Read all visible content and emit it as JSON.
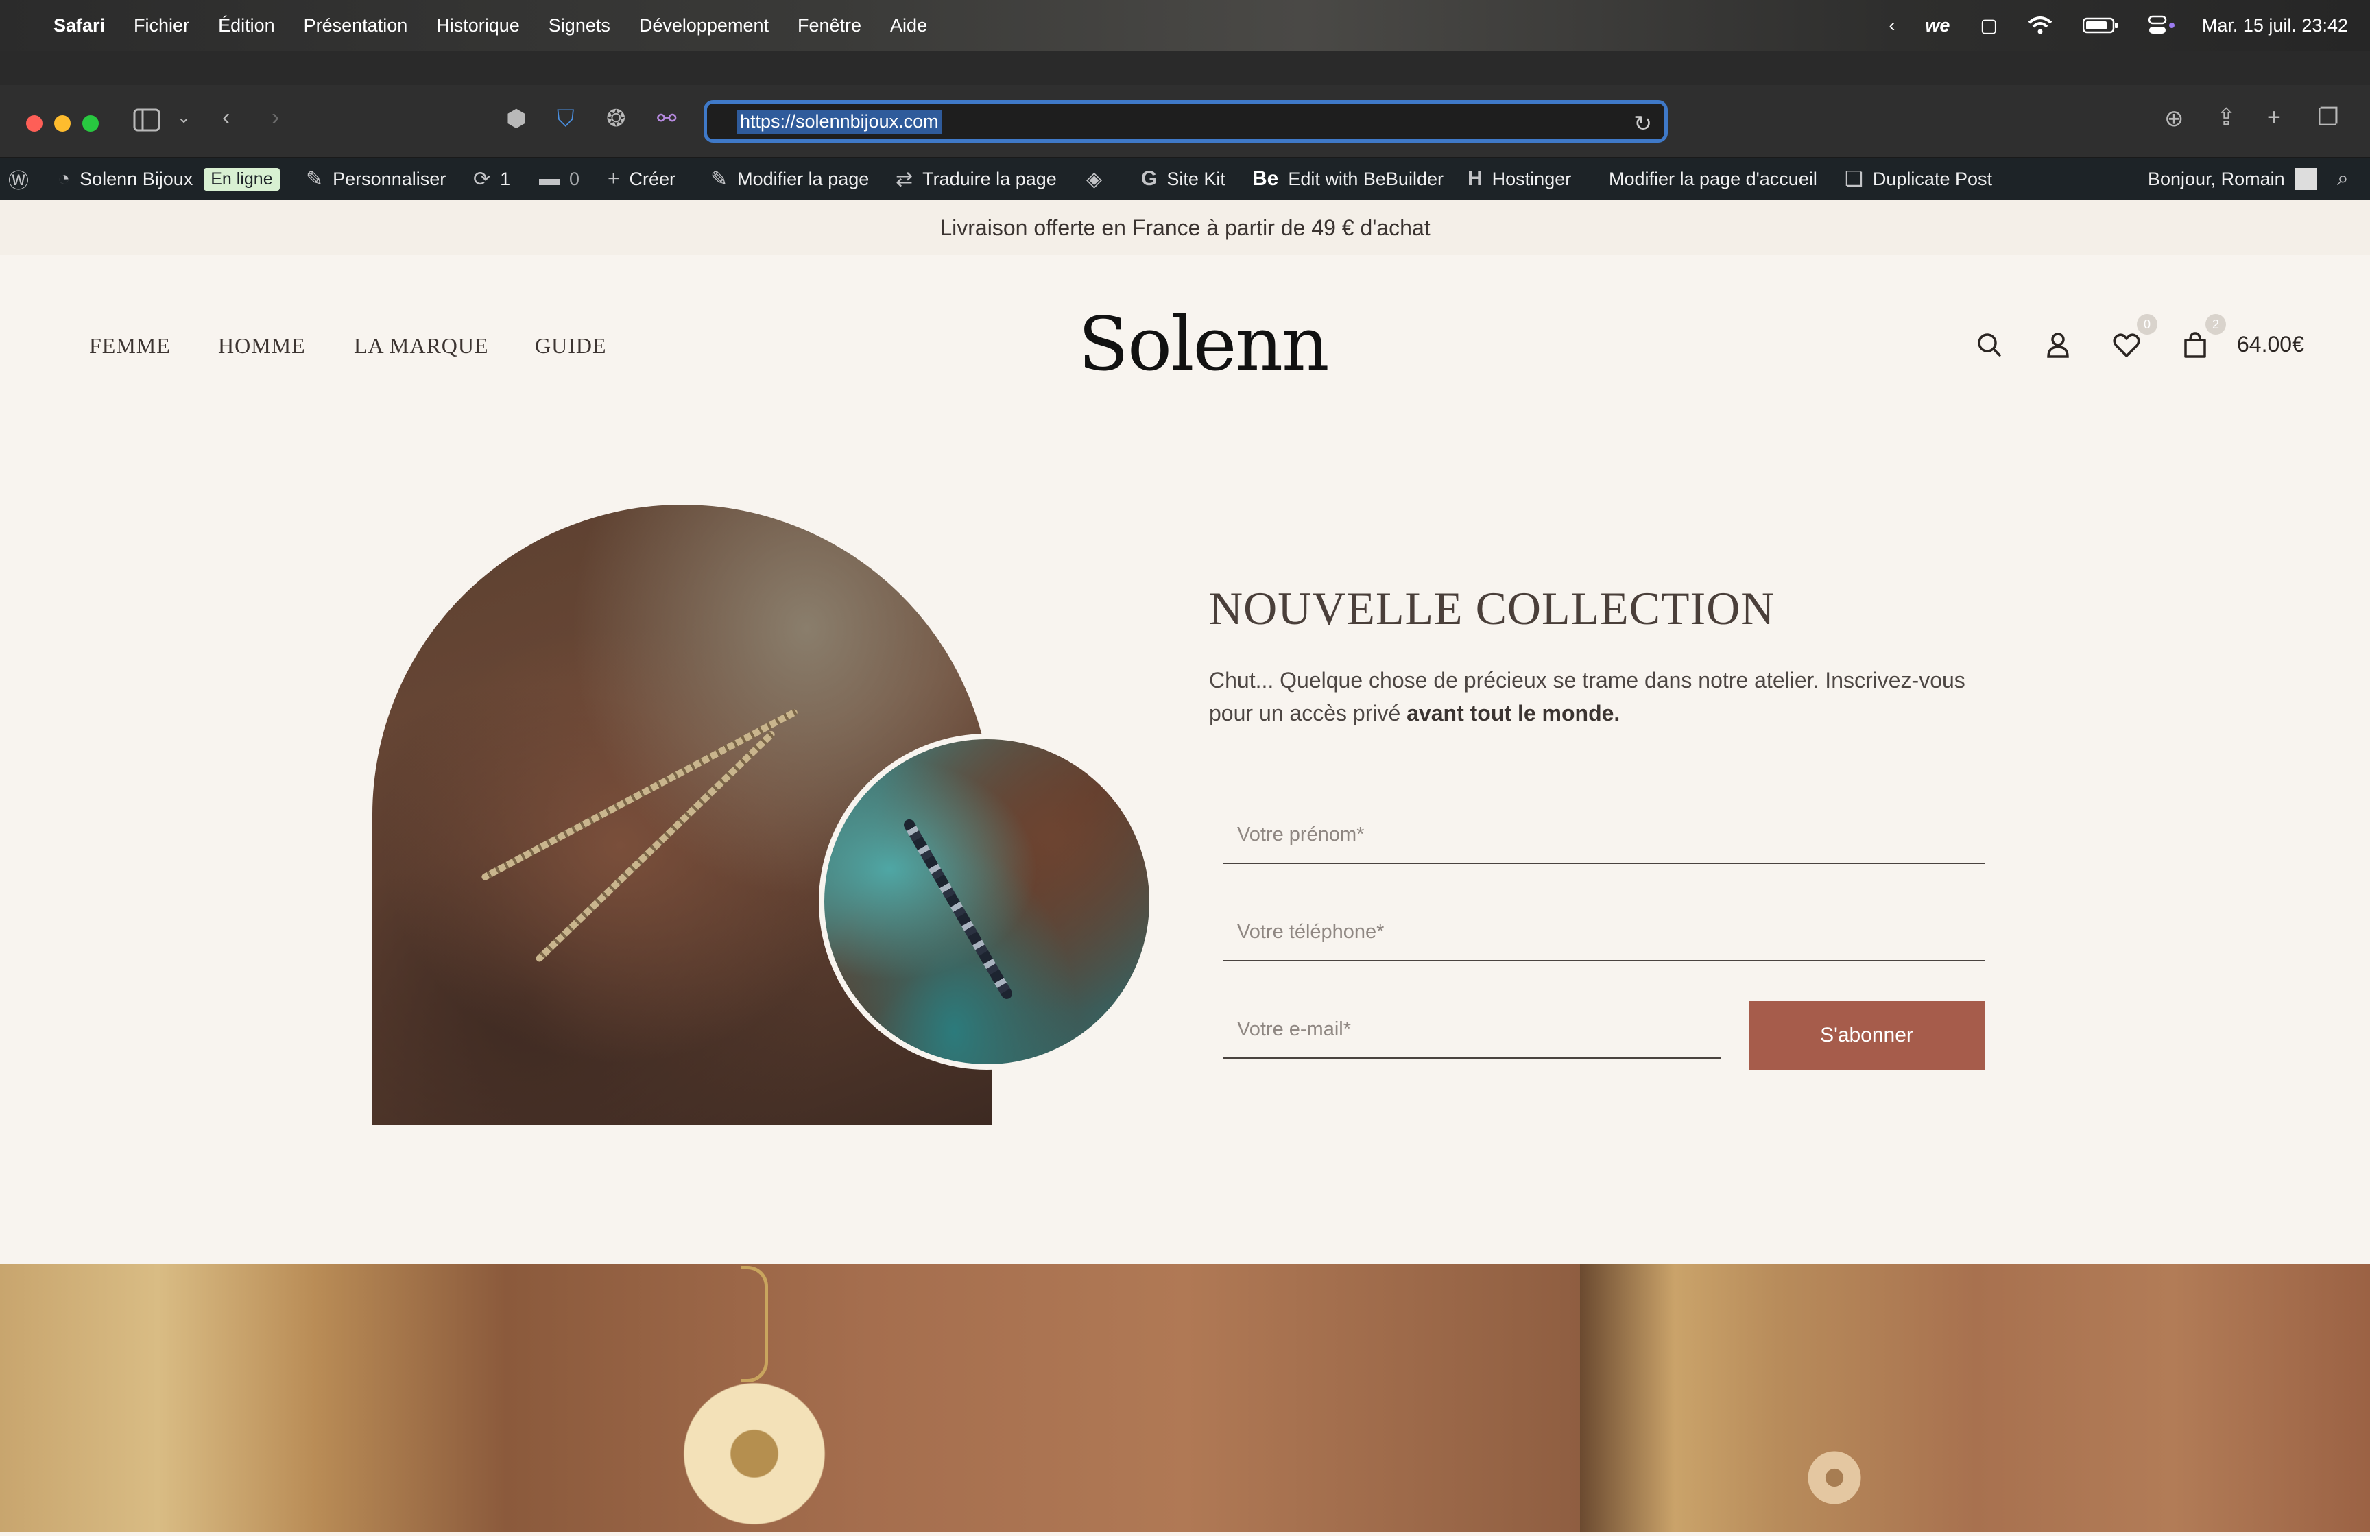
{
  "menubar": {
    "app": "Safari",
    "items": [
      "Fichier",
      "Édition",
      "Présentation",
      "Historique",
      "Signets",
      "Développement",
      "Fenêtre",
      "Aide"
    ],
    "status_icons": [
      "chevron-left-icon",
      "we-icon",
      "screen-icon",
      "wifi-icon",
      "battery-icon",
      "control-center-icon"
    ],
    "date_time": "Mar. 15 juil.  23:42"
  },
  "browser": {
    "url": "https://solennbijoux.com"
  },
  "adminbar": {
    "site_name": "Solenn Bijoux",
    "site_status": "En ligne",
    "customize": "Personnaliser",
    "updates": "1",
    "comments": "0",
    "create": "Créer",
    "edit_page": "Modifier la page",
    "translate_page": "Traduire la page",
    "site_kit": "Site Kit",
    "bebuilder": "Edit with BeBuilder",
    "hostinger": "Hostinger",
    "edit_home": "Modifier la page d'accueil",
    "duplicate": "Duplicate Post",
    "greeting": "Bonjour, Romain"
  },
  "announcement": "Livraison offerte en France à partir de 49 € d'achat",
  "header": {
    "nav": [
      "FEMME",
      "HOMME",
      "LA MARQUE",
      "GUIDE"
    ],
    "logo": "Solenn",
    "wishlist_count": "0",
    "cart_count": "2",
    "cart_total": "64.00€"
  },
  "hero": {
    "title": "NOUVELLE COLLECTION",
    "text": "Chut... Quelque chose de précieux se trame dans notre atelier. Inscrivez-vous pour un accès privé ",
    "text_bold": "avant tout le monde.",
    "firstname_placeholder": "Votre prénom*",
    "phone_placeholder": "Votre téléphone*",
    "email_placeholder": "Votre e-mail*",
    "subscribe": "S'abonner"
  },
  "colors": {
    "accent": "#a65c4b",
    "background": "#f8f4ef",
    "admin_bar": "#1d2327"
  }
}
